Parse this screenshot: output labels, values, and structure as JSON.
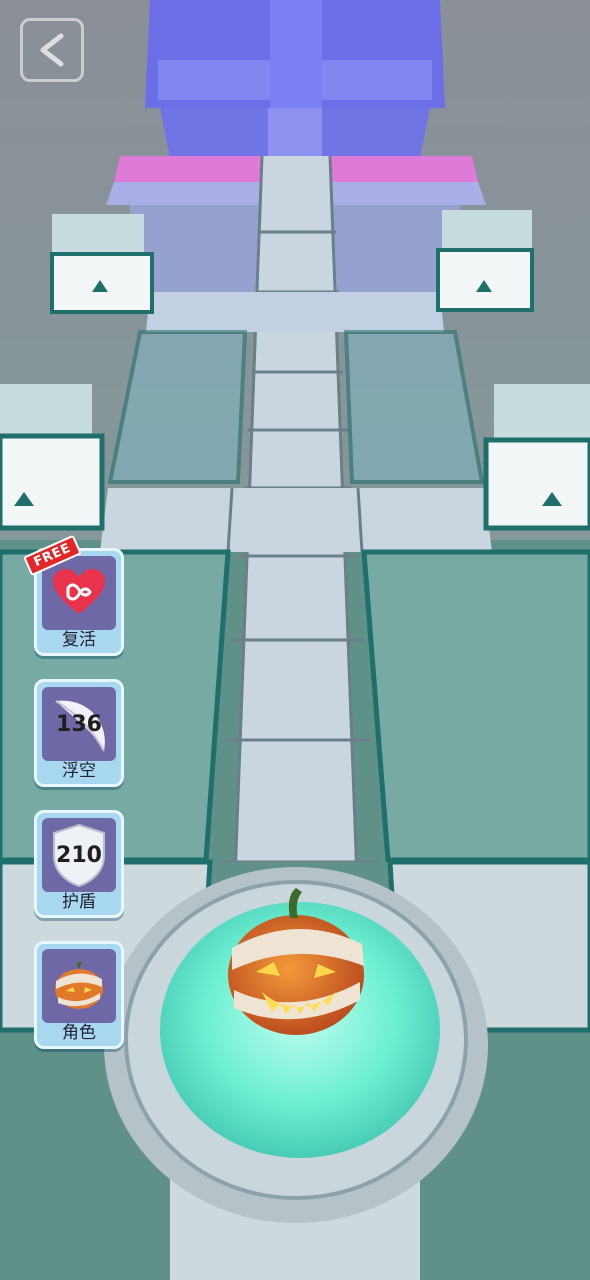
{
  "nav": {
    "back_icon": "chevron-left-icon"
  },
  "powerups": {
    "revive": {
      "badge": "FREE",
      "icon": "heart-infinity-icon",
      "label": "复活"
    },
    "float": {
      "icon": "feather-icon",
      "count": "136",
      "label": "浮空"
    },
    "shield": {
      "icon": "shield-icon",
      "count": "210",
      "label": "护盾"
    },
    "character": {
      "icon": "mummy-pumpkin-icon",
      "label": "角色"
    }
  },
  "colors": {
    "panel_bg": "#a8d8f0",
    "tile_bg": "#6f68a6",
    "badge_red": "#e32626",
    "platform_glow": "#6ff0d2"
  }
}
